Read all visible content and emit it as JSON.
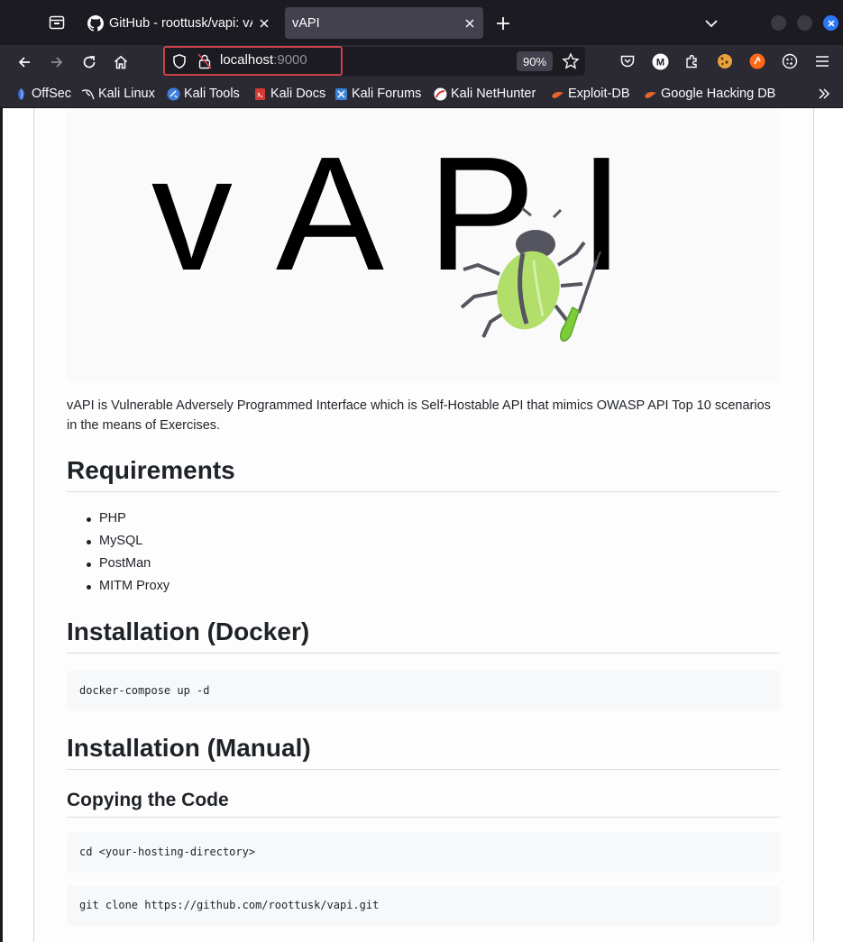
{
  "tabs": [
    {
      "title": "GitHub - roottusk/vapi: vAPI",
      "active": false
    },
    {
      "title": "vAPI",
      "active": true
    }
  ],
  "urlbar": {
    "host": "localhost",
    "port": ":9000",
    "zoom": "90%"
  },
  "bookmarks": [
    {
      "label": "OffSec",
      "icon": "offsec-icon"
    },
    {
      "label": "Kali Linux",
      "icon": "kali-dragon-icon"
    },
    {
      "label": "Kali Tools",
      "icon": "kali-tools-icon"
    },
    {
      "label": "Kali Docs",
      "icon": "kali-docs-icon"
    },
    {
      "label": "Kali Forums",
      "icon": "kali-forums-icon"
    },
    {
      "label": "Kali NetHunter",
      "icon": "nethunter-icon"
    },
    {
      "label": "Exploit-DB",
      "icon": "exploit-db-icon"
    },
    {
      "label": "Google Hacking DB",
      "icon": "ghdb-icon"
    }
  ],
  "colors": {
    "url_focus_border": "#c9424a",
    "bug_body": "#b2df6b",
    "bug_head": "#55555f",
    "window_close": "#2d77f5"
  },
  "page": {
    "logo_text": "vAPI",
    "intro": "vAPI is Vulnerable Adversely Programmed Interface which is Self-Hostable API that mimics OWASP API Top 10 scenarios in the means of Exercises.",
    "requirements_heading": "Requirements",
    "requirements": [
      "PHP",
      "MySQL",
      "PostMan",
      "MITM Proxy"
    ],
    "docker_heading": "Installation (Docker)",
    "docker_cmd": "docker-compose up -d",
    "manual_heading": "Installation (Manual)",
    "copy_heading": "Copying the Code",
    "cd_cmd": "cd <your-hosting-directory>",
    "clone_cmd": "git clone https://github.com/roottusk/vapi.git"
  }
}
